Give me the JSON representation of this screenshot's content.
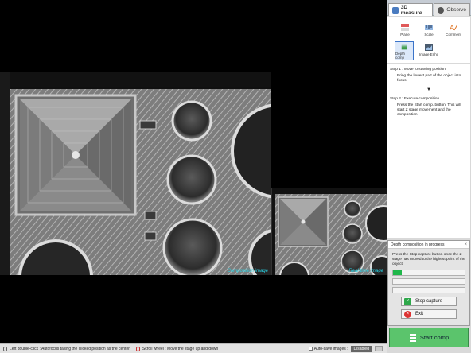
{
  "viewer": {
    "composition_caption": "Composition image",
    "realtime_caption": "Real-time image"
  },
  "statusbar": {
    "left_hint": "Left double-click : Autofocus taking the clicked position as the center",
    "scroll_hint": "Scroll wheel : Move the stage up and down",
    "autosave_label": "Auto-save images :",
    "autosave_state": "Disabled"
  },
  "tabs": [
    {
      "label": "3D measure",
      "icon": "3d-measure-icon",
      "active": true
    },
    {
      "label": "Observe",
      "icon": "camera-icon",
      "active": false
    }
  ],
  "tools": [
    {
      "label": "Plane",
      "icon": "plane-icon"
    },
    {
      "label": "Scale",
      "icon": "scale-icon"
    },
    {
      "label": "Comment",
      "icon": "comment-icon"
    },
    {
      "label": "Depth comp",
      "icon": "depth-comp-icon",
      "selected": true
    },
    {
      "label": "Image Enhc",
      "icon": "image-enhance-icon"
    }
  ],
  "steps": {
    "step1_title": "Step 1 : Move to starting position",
    "step1_body": "Bring the lowest part of the object into focus.",
    "arrow": "▼",
    "step2_title": "Step 2 : Execute composition",
    "step2_body": "Press the Start comp. button. This will start Z stage movement and the composition."
  },
  "dialog": {
    "title": "Depth composition in progress",
    "message": "Press the Stop capture button once the Z stage has moved to the highest point of the object.",
    "progress": 0.12,
    "stop_label": "Stop capture",
    "exit_label": "Exit"
  },
  "start_button": {
    "label": "Start comp"
  },
  "colors": {
    "caption": "#26d6e8",
    "start_button": "#5bc46c",
    "progress_fill": "#1fb74a",
    "badge": "#666666"
  }
}
